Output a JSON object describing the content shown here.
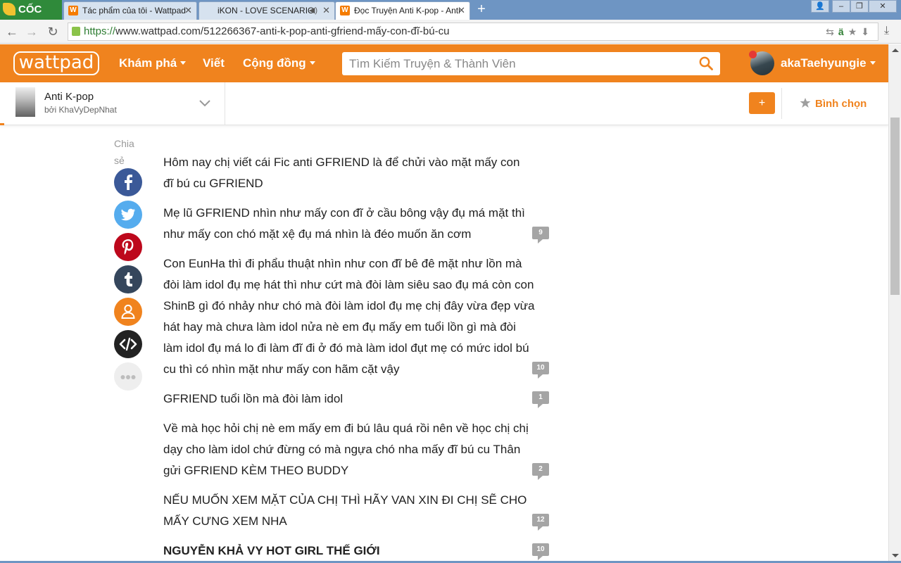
{
  "browser": {
    "logo_text": "CỐC CỐC",
    "tabs": [
      {
        "title": "Tác phẩm của tôi - Wattpad",
        "favicon": "wattpad-favicon"
      },
      {
        "title": "iKON - LOVE SCENARIO",
        "favicon": "none"
      },
      {
        "title": "Đọc Truyện Anti K-pop - Anti",
        "favicon": "wattpad-favicon"
      }
    ],
    "url_scheme": "https://",
    "url_rest": "www.wattpad.com/512266367-anti-k-pop-anti-gfriend-mấy-con-đĩ-bú-cu",
    "translate_glyph": "ä"
  },
  "header": {
    "logo_text": "wattpad",
    "nav": [
      {
        "label": "Khám phá",
        "has_caret": true
      },
      {
        "label": "Viết",
        "has_caret": false
      },
      {
        "label": "Cộng đồng",
        "has_caret": true
      }
    ],
    "search_placeholder": "Tìm Kiếm Truyện & Thành Viên",
    "username": "akaTaehyungie",
    "accent_color": "#f0831e"
  },
  "story": {
    "title": "Anti K-pop",
    "author": "bởi KhaVyDepNhat",
    "add_label": "+",
    "vote_label": "Bình chọn"
  },
  "share": {
    "label": "Chia sẻ",
    "buttons": [
      "facebook-icon",
      "twitter-icon",
      "pinterest-icon",
      "tumblr-icon",
      "user-icon",
      "embed-icon",
      "more-icon"
    ]
  },
  "paragraphs": [
    {
      "text": "Hôm nay chị viết cái Fic anti GFRIEND là để chửi vào mặt mấy con đĩ bú cu GFRIEND",
      "comments": ""
    },
    {
      "text": "Mẹ lũ GFRIEND nhìn như mấy con đĩ ở cầu bông vậy đụ má mặt thì như mấy con chó mặt xệ đụ má nhìn là đéo muốn ăn cơm",
      "comments": "9"
    },
    {
      "text": "Con EunHa thì đi phẩu thuật nhìn như con đĩ bê đê mặt như lồn mà đòi làm idol đụ mẹ hát thì như cứt mà đòi làm siêu sao đụ má còn con ShinB gì đó nhảy như chó mà đòi làm idol đụ mẹ chị đây vừa đẹp vừa hát hay mà chưa làm idol nửa nè em đụ mấy em tuổi lồn gì mà đòi làm idol đụ má lo đi làm đĩ đi ở đó mà làm idol đụt mẹ có mức idol bú cu thì có nhìn mặt như mấy con hãm cặt vậy",
      "comments": "10"
    },
    {
      "text": "GFRIEND tuổi lồn mà đòi làm idol",
      "comments": "1"
    },
    {
      "text": "Về mà học hỏi chị nè em mấy em đi bú lâu quá rồi nên về học chị chị dạy cho làm idol chứ đừng có mà ngựa chó nha mấy đĩ bú cu Thân gửi GFRIEND KÈM THEO BUDDY",
      "comments": "2"
    },
    {
      "text": "NẾU MUỐN XEM MẶT CỦA CHỊ THÌ HÃY VAN XIN ĐI CHỊ SẼ CHO MẤY CƯNG XEM NHA",
      "comments": "12"
    },
    {
      "text": "NGUYỄN KHẢ VY HOT GIRL THẾ GIỚI",
      "comments": "10"
    }
  ]
}
